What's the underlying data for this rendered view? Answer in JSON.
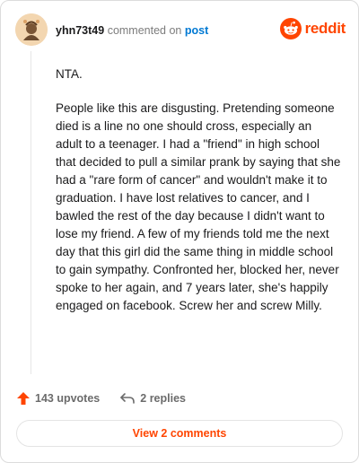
{
  "header": {
    "username": "yhn73t49",
    "commented_text": "commented on",
    "post_link": "post",
    "brand": "reddit"
  },
  "comment": {
    "paragraphs": [
      "NTA.",
      "People like this are disgusting. Pretending someone died is a line no one should cross, especially an adult to a teenager. I had a \"friend\" in high school that decided to pull a similar prank by saying that she had a \"rare form of cancer\" and wouldn't make it to graduation. I have lost relatives to cancer, and I bawled the rest of the day because I didn't want to lose my friend. A few of my friends told me the next day that this girl did the same thing in middle school to gain sympathy. Confronted her, blocked her, never spoke to her again, and 7 years later, she's happily engaged on facebook. Screw her and screw Milly."
    ]
  },
  "actions": {
    "upvotes": "143 upvotes",
    "replies": "2 replies",
    "view_comments": "View 2 comments"
  },
  "icons": {
    "upvote": "upvote-arrow-icon",
    "reply": "reply-arrow-icon",
    "brand": "reddit-snoo-icon"
  },
  "colors": {
    "brand": "#ff4500",
    "link": "#0079d3",
    "muted": "#7c7c7c"
  }
}
